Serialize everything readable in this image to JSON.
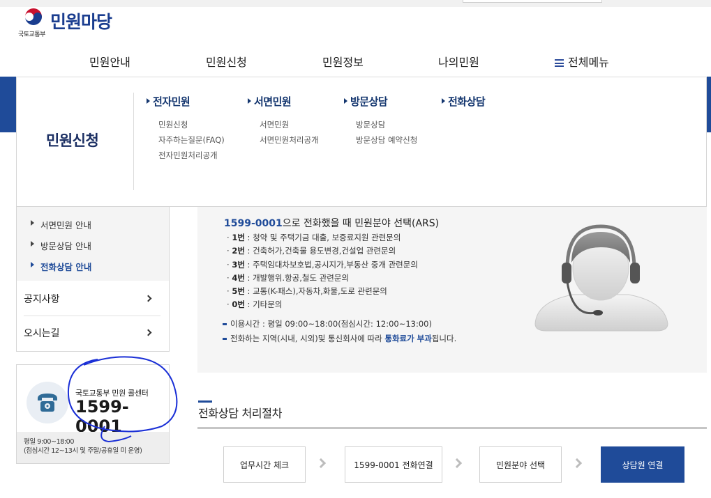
{
  "header": {
    "ministry": "국토교통부",
    "site_title": "민원마당"
  },
  "gnb": [
    {
      "label": "민원안내"
    },
    {
      "label": "민원신청"
    },
    {
      "label": "민원정보"
    },
    {
      "label": "나의민원"
    },
    {
      "label": "전체메뉴"
    }
  ],
  "mega_menu": {
    "title": "민원신청",
    "columns": [
      {
        "heading": "전자민원",
        "links": [
          "민원신청",
          "자주하는질문(FAQ)",
          "전자민원처리공개"
        ]
      },
      {
        "heading": "서면민원",
        "links": [
          "서면민원",
          "서면민원처리공개"
        ]
      },
      {
        "heading": "방문상담",
        "links": [
          "방문상담",
          "방문상담 예약신청"
        ]
      },
      {
        "heading": "전화상담",
        "links": []
      }
    ]
  },
  "side_menu": {
    "sub_items": [
      {
        "label": "서면민원 안내"
      },
      {
        "label": "방문상담 안내"
      },
      {
        "label": "전화상담 안내"
      }
    ],
    "main_items": [
      {
        "label": "공지사항"
      },
      {
        "label": "오시는길"
      }
    ]
  },
  "call_center": {
    "label": "국토교통부 민원 콜센터",
    "number": "1599-0001",
    "hours_line1": "평일 9:00~18:00",
    "hours_line2": "(점심시간 12~13시 및 주말/공휴일 미 운영)"
  },
  "ars": {
    "title_number": "1599-0001",
    "title_rest": "으로 전화했을 때 민원분야 선택(ARS)",
    "options": [
      {
        "key": "1번",
        "desc": "청약 및 주택기금 대출, 보증료지원 관련문의"
      },
      {
        "key": "2번",
        "desc": "건축허가,건축물 용도변경,건설업 관련문의"
      },
      {
        "key": "3번",
        "desc": "주택임대차보호법,공시지가,부동산 중개 관련문의"
      },
      {
        "key": "4번",
        "desc": "개발행위.항공,철도 관련문의"
      },
      {
        "key": "5번",
        "desc": "교통(K-패스),자동차,화물,도로 관련문의"
      },
      {
        "key": "0번",
        "desc": "기타문의"
      }
    ],
    "note1": "이용시간 : 평일 09:00~18:00(점심시간: 12:00~13:00)",
    "note2_pre": "전화하는 지역(시내, 시외)및 통신회사에 따라 ",
    "note2_hl": "통화료가 부과",
    "note2_post": "됩니다."
  },
  "procedure": {
    "title": "전화상담 처리절차",
    "steps": [
      "업무시간 체크",
      "1599-0001 전화연결",
      "민원분야 선택",
      "상담원 연결"
    ]
  },
  "colors": {
    "brand_blue": "#1f4b99",
    "annotation_ink": "#1a2fd6"
  }
}
